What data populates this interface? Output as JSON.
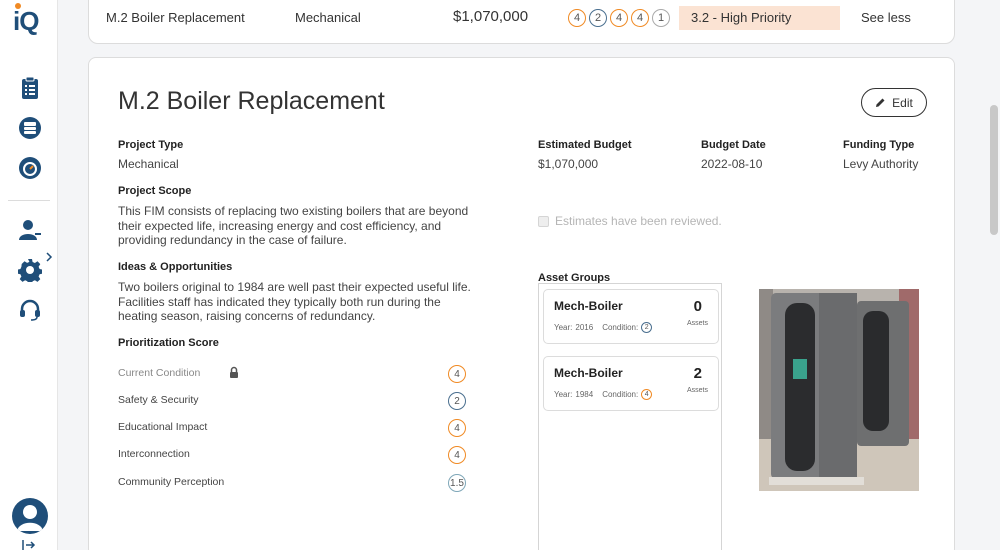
{
  "app": {
    "logo_text": "iQ"
  },
  "sidebar": {
    "icons": [
      "clipboard-list-icon",
      "server-list-icon",
      "gauge-icon",
      "user-edit-icon",
      "gear-icon",
      "headset-icon"
    ]
  },
  "project_row": {
    "name": "M.2 Boiler Replacement",
    "type": "Mechanical",
    "budget": "$1,070,000",
    "scores": [
      "4",
      "2",
      "4",
      "4",
      "1"
    ],
    "priority": "3.2 - High Priority",
    "toggle_label": "See less"
  },
  "detail": {
    "title": "M.2 Boiler Replacement",
    "edit_label": "Edit",
    "project_type_label": "Project Type",
    "project_type": "Mechanical",
    "scope_label": "Project Scope",
    "scope_lines": [
      "This FIM consists of replacing two existing boilers that are beyond",
      "their expected life, increasing energy and cost efficiency, and",
      "providing redundancy in the case of failure."
    ],
    "ideas_label": "Ideas & Opportunities",
    "ideas_lines": [
      "Two boilers original to 1984 are well past their expected useful life.",
      "Facilities staff has indicated they typically both run during the",
      "heating season, raising concerns of redundancy."
    ],
    "prioritization_label": "Prioritization Score",
    "scores": [
      {
        "label": "Current Condition",
        "value": "4",
        "color": "#f08a24",
        "locked": true
      },
      {
        "label": "Safety & Security",
        "value": "2",
        "color": "#4a6f8f",
        "locked": false
      },
      {
        "label": "Educational Impact",
        "value": "4",
        "color": "#f08a24",
        "locked": false
      },
      {
        "label": "Interconnection",
        "value": "4",
        "color": "#f08a24",
        "locked": false
      },
      {
        "label": "Community Perception",
        "value": "1.5",
        "color": "#7fa7b8",
        "locked": false
      }
    ],
    "budget_label": "Estimated Budget",
    "budget": "$1,070,000",
    "budget_date_label": "Budget Date",
    "budget_date": "2022-08-10",
    "funding_label": "Funding Type",
    "funding": "Levy Authority",
    "review_label": "Estimates have been reviewed.",
    "asset_groups_label": "Asset Groups",
    "asset_groups": [
      {
        "name": "Mech-Boiler",
        "year_label": "Year:",
        "year": "2016",
        "condition_label": "Condition:",
        "condition": "2",
        "condition_color": "#4a6f8f",
        "count": "0",
        "count_label": "Assets"
      },
      {
        "name": "Mech-Boiler",
        "year_label": "Year:",
        "year": "1984",
        "condition_label": "Condition:",
        "condition": "4",
        "condition_color": "#f08a24",
        "count": "2",
        "count_label": "Assets"
      }
    ]
  },
  "colors": {
    "orange": "#f08a24",
    "navy": "#1f4e79",
    "priority_bg": "#fbe3d3"
  }
}
